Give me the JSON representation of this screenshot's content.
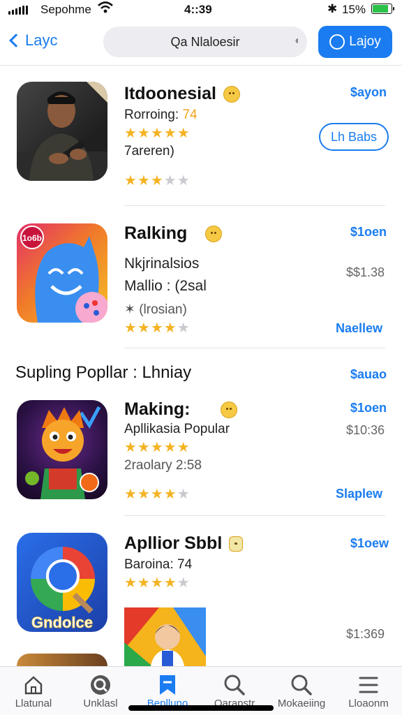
{
  "status_bar": {
    "carrier": "Sepohme",
    "time": "4::39",
    "battery_percent": "15%",
    "battery_level": 0.85
  },
  "nav": {
    "back_label": "Layc",
    "search_text": "Qa Nlaloesir",
    "action_label": "Lajoy"
  },
  "apps": [
    {
      "name": "Itdoonesial",
      "line1_label": "Rorroing:",
      "line1_value": "74",
      "line2": "7areren)",
      "rating_top": "★★★★★",
      "rating_bottom": "★★★★★",
      "link": "$ayon",
      "button": "Lh Babs"
    },
    {
      "name": "Ralking",
      "line1": "Nkjrinalsios",
      "line2": "Mallio : (2sal",
      "line3": "(lrosian)",
      "rating": "★★★★★",
      "link": "$1oen",
      "price": "$$1.38",
      "link2": "Naellew",
      "icon_badge": "1o6b"
    },
    {
      "name": "Making:",
      "line1": "Apllikasia Popular",
      "line2": "2raolary  2:58",
      "rating_top": "★★★★★",
      "rating_bottom": "★★★★★",
      "link": "$1oen",
      "price": "$10:36",
      "link2": "Slaplew"
    },
    {
      "name": "Apllior Sbbl",
      "line1": "Baroina: 74",
      "rating": "★★★★★",
      "link": "$1oew",
      "price": "$1:369",
      "icon_text": "Gndolce"
    }
  ],
  "section": {
    "title": "Supling Popllar : Lhniay",
    "link": "$auao"
  },
  "tabs": [
    {
      "label": "Llatunal",
      "icon": "home-icon"
    },
    {
      "label": "Unklasl",
      "icon": "search-circle-icon"
    },
    {
      "label": "Beplluno",
      "icon": "bookmark-icon"
    },
    {
      "label": "Qarapstr",
      "icon": "search-icon"
    },
    {
      "label": "Mokaeiing",
      "icon": "search-icon"
    },
    {
      "label": "Lloaonm",
      "icon": "menu-icon"
    }
  ],
  "colors": {
    "accent": "#1a7cf0",
    "star": "#f4b323",
    "battery": "#2bc24a"
  }
}
